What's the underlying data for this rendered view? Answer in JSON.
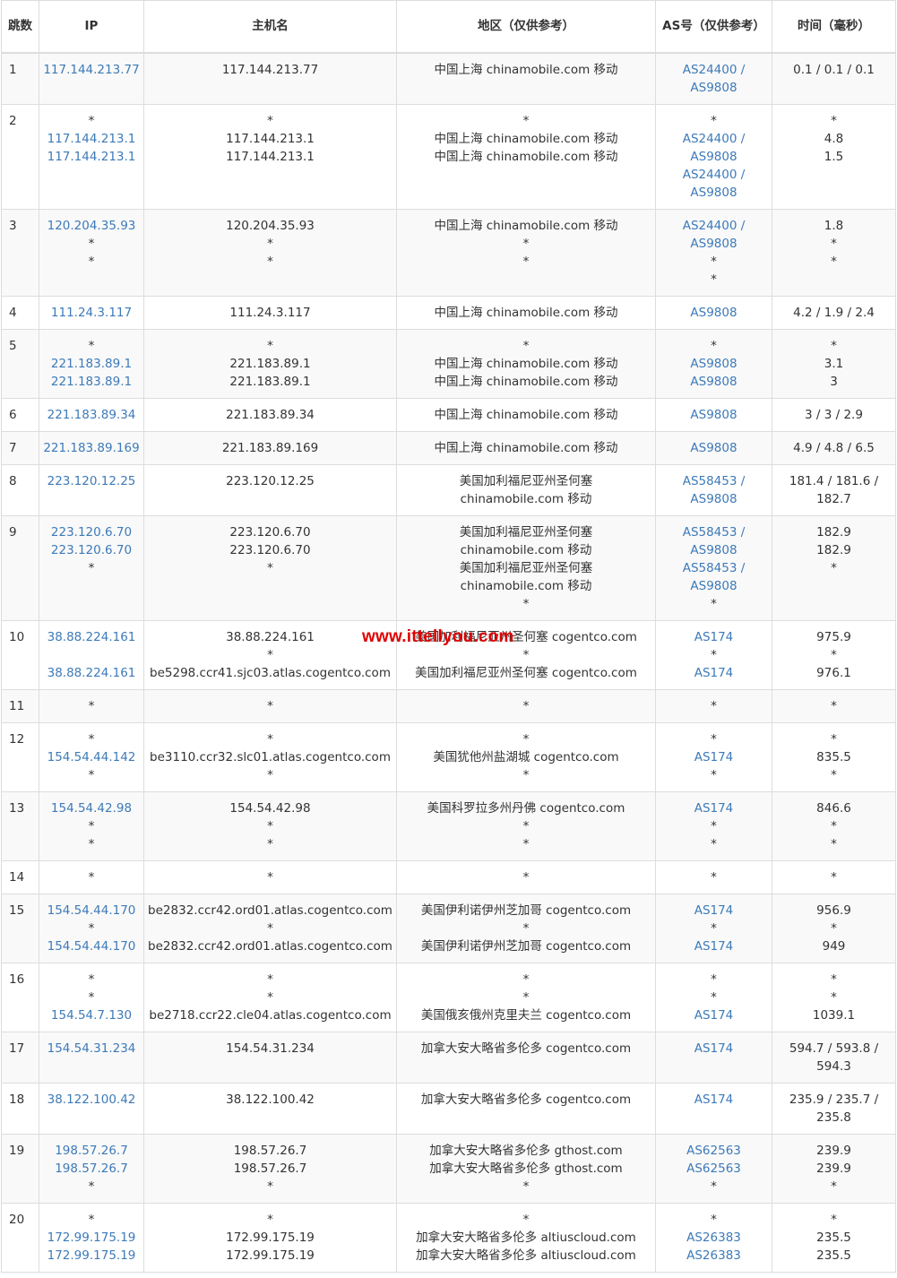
{
  "headers": {
    "hop": "跳数",
    "ip": "IP",
    "host": "主机名",
    "loc": "地区（仅供参考）",
    "as": "AS号（仅供参考）",
    "time": "时间（毫秒）"
  },
  "watermark": "www.ittellyou.com",
  "rows": [
    {
      "hop": "1",
      "ip": [
        "117.144.213.77"
      ],
      "host": [
        "117.144.213.77"
      ],
      "loc": [
        "中国上海 chinamobile.com 移动"
      ],
      "as": [
        "AS24400 /",
        "AS9808"
      ],
      "time": [
        "0.1 / 0.1 / 0.1"
      ],
      "h": 57
    },
    {
      "hop": "2",
      "ip": [
        "*",
        "117.144.213.1",
        "117.144.213.1"
      ],
      "host": [
        "*",
        "117.144.213.1",
        "117.144.213.1"
      ],
      "loc": [
        "*",
        "中国上海 chinamobile.com 移动",
        "中国上海 chinamobile.com 移动"
      ],
      "as": [
        "*",
        "AS24400 /",
        "AS9808",
        "AS24400 /",
        "AS9808"
      ],
      "time": [
        "*",
        "4.8",
        "1.5"
      ],
      "h": 117
    },
    {
      "hop": "3",
      "ip": [
        "120.204.35.93",
        "*",
        "*"
      ],
      "host": [
        "120.204.35.93",
        "*",
        "*"
      ],
      "loc": [
        "中国上海 chinamobile.com 移动",
        "*",
        "*"
      ],
      "as": [
        "AS24400 /",
        "AS9808",
        "*",
        "*"
      ],
      "time": [
        "1.8",
        "*",
        "*"
      ],
      "h": 97
    },
    {
      "hop": "4",
      "ip": [
        "111.24.3.117"
      ],
      "host": [
        "111.24.3.117"
      ],
      "loc": [
        "中国上海 chinamobile.com 移动"
      ],
      "as": [
        "AS9808"
      ],
      "time": [
        "4.2 / 1.9 / 2.4"
      ],
      "h": 37
    },
    {
      "hop": "5",
      "ip": [
        "*",
        "221.183.89.1",
        "221.183.89.1"
      ],
      "host": [
        "*",
        "221.183.89.1",
        "221.183.89.1"
      ],
      "loc": [
        "*",
        "中国上海 chinamobile.com 移动",
        "中国上海 chinamobile.com 移动"
      ],
      "as": [
        "*",
        "AS9808",
        "AS9808"
      ],
      "time": [
        "*",
        "3.1",
        "3"
      ],
      "h": 77
    },
    {
      "hop": "6",
      "ip": [
        "221.183.89.34"
      ],
      "host": [
        "221.183.89.34"
      ],
      "loc": [
        "中国上海 chinamobile.com 移动"
      ],
      "as": [
        "AS9808"
      ],
      "time": [
        "3 / 3 / 2.9"
      ],
      "h": 37
    },
    {
      "hop": "7",
      "ip": [
        "221.183.89.169"
      ],
      "host": [
        "221.183.89.169"
      ],
      "loc": [
        "中国上海 chinamobile.com 移动"
      ],
      "as": [
        "AS9808"
      ],
      "time": [
        "4.9 / 4.8 / 6.5"
      ],
      "h": 37
    },
    {
      "hop": "8",
      "ip": [
        "223.120.12.25"
      ],
      "host": [
        "223.120.12.25"
      ],
      "loc": [
        "美国加利福尼亚州圣何塞",
        "chinamobile.com 移动"
      ],
      "as": [
        "AS58453 /",
        "AS9808"
      ],
      "time": [
        "181.4 / 181.6 /",
        "182.7"
      ],
      "h": 57
    },
    {
      "hop": "9",
      "ip": [
        "223.120.6.70",
        "223.120.6.70",
        "*"
      ],
      "host": [
        "223.120.6.70",
        "223.120.6.70",
        "*"
      ],
      "loc": [
        "美国加利福尼亚州圣何塞",
        "chinamobile.com 移动",
        "美国加利福尼亚州圣何塞",
        "chinamobile.com 移动",
        "*"
      ],
      "as": [
        "AS58453 /",
        "AS9808",
        "AS58453 /",
        "AS9808",
        "*"
      ],
      "time": [
        "182.9",
        "182.9",
        "*"
      ],
      "h": 117
    },
    {
      "hop": "10",
      "ip": [
        "38.88.224.161",
        "",
        "38.88.224.161"
      ],
      "host": [
        "38.88.224.161",
        "*",
        "be5298.ccr41.sjc03.atlas.cogentco.com"
      ],
      "loc": [
        "美国加利福尼亚州圣何塞 cogentco.com",
        "*",
        "美国加利福尼亚州圣何塞 cogentco.com"
      ],
      "as": [
        "AS174",
        "*",
        "AS174"
      ],
      "time": [
        "975.9",
        "*",
        "976.1"
      ],
      "h": 77
    },
    {
      "hop": "11",
      "ip": [
        "*"
      ],
      "host": [
        "*"
      ],
      "loc": [
        "*"
      ],
      "as": [
        "*"
      ],
      "time": [
        "*"
      ],
      "h": 37
    },
    {
      "hop": "12",
      "ip": [
        "*",
        "154.54.44.142",
        "*"
      ],
      "host": [
        "*",
        "be3110.ccr32.slc01.atlas.cogentco.com",
        "*"
      ],
      "loc": [
        "*",
        "美国犹他州盐湖城 cogentco.com",
        "*"
      ],
      "as": [
        "*",
        "AS174",
        "*"
      ],
      "time": [
        "*",
        "835.5",
        "*"
      ],
      "h": 77
    },
    {
      "hop": "13",
      "ip": [
        "154.54.42.98",
        "*",
        "*"
      ],
      "host": [
        "154.54.42.98",
        "*",
        "*"
      ],
      "loc": [
        "美国科罗拉多州丹佛 cogentco.com",
        "*",
        "*"
      ],
      "as": [
        "AS174",
        "*",
        "*"
      ],
      "time": [
        "846.6",
        "*",
        "*"
      ],
      "h": 77
    },
    {
      "hop": "14",
      "ip": [
        "*"
      ],
      "host": [
        "*"
      ],
      "loc": [
        "*"
      ],
      "as": [
        "*"
      ],
      "time": [
        "*"
      ],
      "h": 37
    },
    {
      "hop": "15",
      "ip": [
        "154.54.44.170",
        "*",
        "154.54.44.170"
      ],
      "host": [
        "be2832.ccr42.ord01.atlas.cogentco.com",
        "*",
        "be2832.ccr42.ord01.atlas.cogentco.com"
      ],
      "loc": [
        "美国伊利诺伊州芝加哥 cogentco.com",
        "*",
        "美国伊利诺伊州芝加哥 cogentco.com"
      ],
      "as": [
        "AS174",
        "*",
        "AS174"
      ],
      "time": [
        "956.9",
        "*",
        "949"
      ],
      "h": 77
    },
    {
      "hop": "16",
      "ip": [
        "*",
        "*",
        "154.54.7.130"
      ],
      "host": [
        "*",
        "*",
        "be2718.ccr22.cle04.atlas.cogentco.com"
      ],
      "loc": [
        "*",
        "*",
        "美国俄亥俄州克里夫兰 cogentco.com"
      ],
      "as": [
        "*",
        "*",
        "AS174"
      ],
      "time": [
        "*",
        "*",
        "1039.1"
      ],
      "h": 77
    },
    {
      "hop": "17",
      "ip": [
        "154.54.31.234"
      ],
      "host": [
        "154.54.31.234"
      ],
      "loc": [
        "加拿大安大略省多伦多 cogentco.com"
      ],
      "as": [
        "AS174"
      ],
      "time": [
        "594.7 / 593.8 /",
        "594.3"
      ],
      "h": 57
    },
    {
      "hop": "18",
      "ip": [
        "38.122.100.42"
      ],
      "host": [
        "38.122.100.42"
      ],
      "loc": [
        "加拿大安大略省多伦多 cogentco.com"
      ],
      "as": [
        "AS174"
      ],
      "time": [
        "235.9 / 235.7 /",
        "235.8"
      ],
      "h": 57
    },
    {
      "hop": "19",
      "ip": [
        "198.57.26.7",
        "198.57.26.7",
        "*"
      ],
      "host": [
        "198.57.26.7",
        "198.57.26.7",
        "*"
      ],
      "loc": [
        "加拿大安大略省多伦多 gthost.com",
        "加拿大安大略省多伦多 gthost.com",
        "*"
      ],
      "as": [
        "AS62563",
        "AS62563",
        "*"
      ],
      "time": [
        "239.9",
        "239.9",
        "*"
      ],
      "h": 77
    },
    {
      "hop": "20",
      "ip": [
        "*",
        "172.99.175.19",
        "172.99.175.19"
      ],
      "host": [
        "*",
        "172.99.175.19",
        "172.99.175.19"
      ],
      "loc": [
        "*",
        "加拿大安大略省多伦多 altiuscloud.com",
        "加拿大安大略省多伦多 altiuscloud.com"
      ],
      "as": [
        "*",
        "AS26383",
        "AS26383"
      ],
      "time": [
        "*",
        "235.5",
        "235.5"
      ],
      "h": 77
    }
  ]
}
